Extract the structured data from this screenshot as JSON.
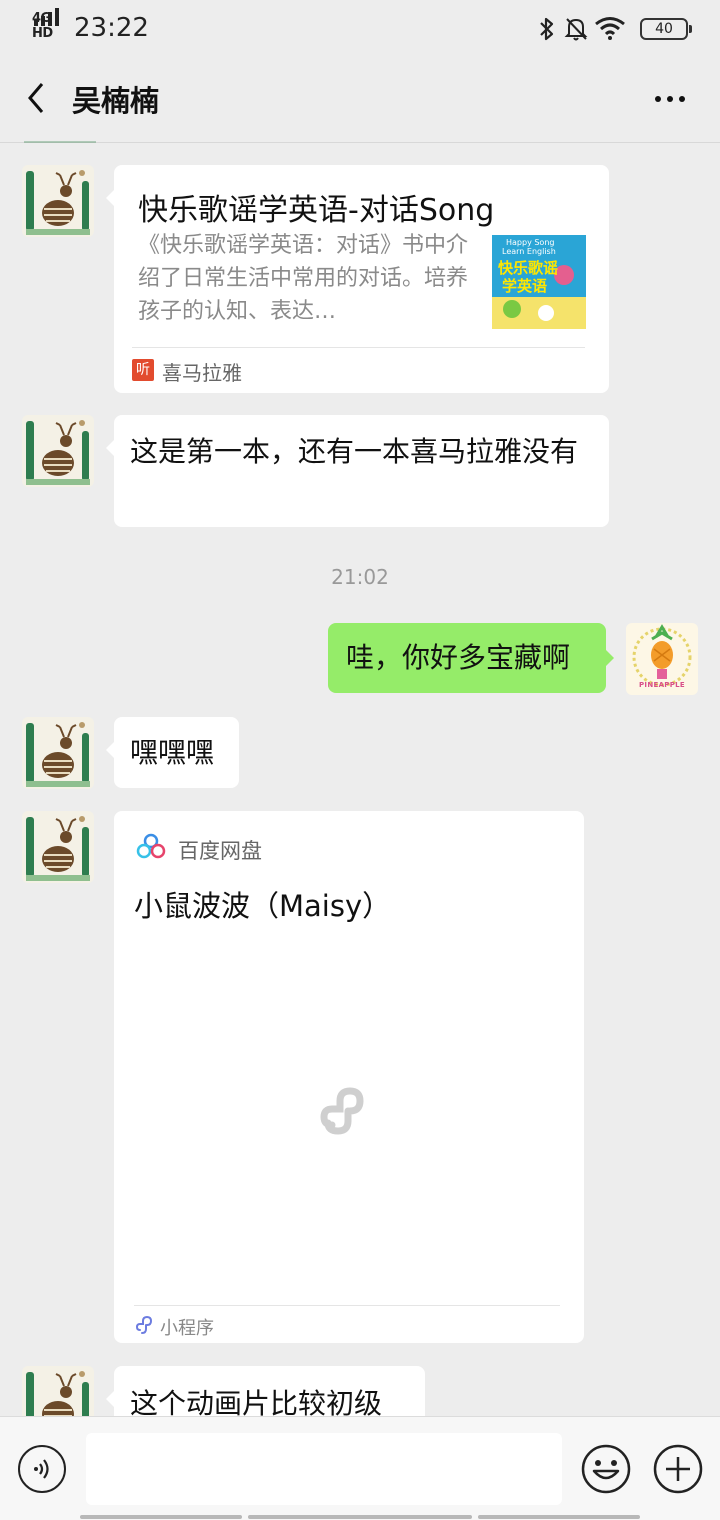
{
  "status_bar": {
    "network": "4G HD",
    "time": "23:22",
    "battery": "40",
    "icons": [
      "bluetooth-icon",
      "mute-bell-icon",
      "wifi-icon",
      "battery-icon"
    ]
  },
  "header": {
    "title": "吴楠楠",
    "back_icon": "chevron-left-icon",
    "more_icon": "more-dots-icon"
  },
  "messages": [
    {
      "type": "link_card",
      "sender": "other",
      "title": "快乐歌谣学英语-对话Song",
      "description": "《快乐歌谣学英语：对话》书中介绍了日常生活中常用的对话。培养孩子的认知、表达…",
      "source": "喜马拉雅",
      "source_badge": "听",
      "thumbnail": {
        "line1": "Happy Song",
        "line2": "Learn English",
        "line3": "快乐歌谣",
        "line4": "学英语"
      }
    },
    {
      "type": "text",
      "sender": "other",
      "text": "这是第一本，还有一本喜马拉雅没有"
    },
    {
      "type": "timestamp",
      "text": "21:02"
    },
    {
      "type": "text",
      "sender": "self",
      "text": "哇，你好多宝藏啊"
    },
    {
      "type": "text",
      "sender": "other",
      "text": "嘿嘿嘿"
    },
    {
      "type": "mini_program",
      "sender": "other",
      "source": "百度网盘",
      "title": "小鼠波波（Maisy）",
      "label": "小程序"
    },
    {
      "type": "text",
      "sender": "other",
      "text": "这个动画片比较初级"
    }
  ],
  "self_avatar_text": "PINEAPPLE",
  "input_bar": {
    "input_value": "",
    "voice_icon": "voice-icon",
    "emoji_icon": "emoji-icon",
    "add_icon": "plus-icon"
  },
  "colors": {
    "background": "#ededed",
    "self_bubble": "#95ec69",
    "other_bubble": "#ffffff",
    "source_badge": "#e24b2e"
  }
}
